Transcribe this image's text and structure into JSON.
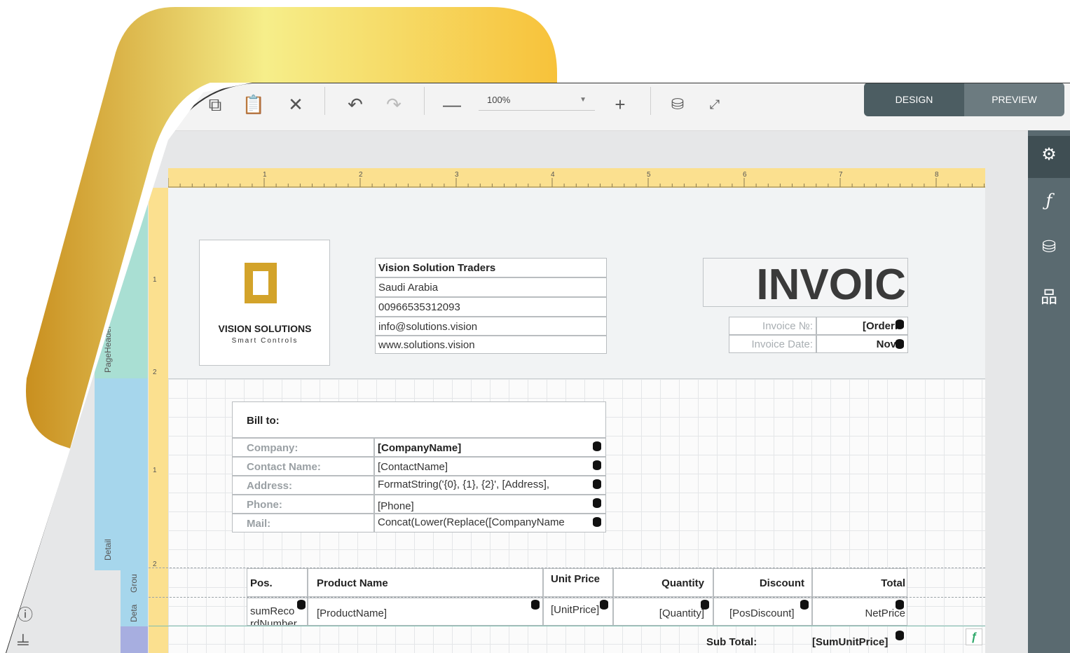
{
  "toolbar": {
    "zoom_value": "100%",
    "modes": {
      "design": "DESIGN",
      "preview": "PREVIEW"
    }
  },
  "bands": {
    "page_header": "PageHeader",
    "detail": "Detail",
    "group": "Grou",
    "detail2": "Deta"
  },
  "ruler": {
    "top": [
      "1",
      "2",
      "3",
      "4",
      "5",
      "6",
      "7",
      "8"
    ],
    "left_header": [
      "1",
      "2"
    ],
    "left_detail": [
      "1",
      "2"
    ]
  },
  "logo": {
    "name": "VISION SOLUTIONS",
    "tagline": "Smart Controls",
    "brand_color": "#d3a32a"
  },
  "company": {
    "name": "Vision Solution Traders",
    "country": "Saudi Arabia",
    "phone": "00966535312093",
    "email": "info@solutions.vision",
    "web": "www.solutions.vision"
  },
  "invoice": {
    "title": "INVOIC",
    "number_label": "Invoice №:",
    "number_value": "[OrderI",
    "date_label": "Invoice Date:",
    "date_value": "Nov"
  },
  "bill_to": {
    "heading": "Bill to:",
    "rows": [
      {
        "label": "Company:",
        "value": "[CompanyName]"
      },
      {
        "label": "Contact Name:",
        "value": "[ContactName]"
      },
      {
        "label": "Address:",
        "value": "FormatString('{0}, {1}, {2}', [Address],"
      },
      {
        "label": "Phone:",
        "value": "[Phone]"
      },
      {
        "label": "Mail:",
        "value": "Concat(Lower(Replace([CompanyName"
      }
    ]
  },
  "table": {
    "headers": [
      "Pos.",
      "Product Name",
      "Unit Price",
      "Quantity",
      "Discount",
      "Total"
    ],
    "row": [
      "sumRecordNumber",
      "[ProductName]",
      "[UnitPrice]",
      "[Quantity]",
      "[PosDiscount]",
      "NetPrice"
    ]
  },
  "subtotal": {
    "label": "Sub Total:",
    "value": "[SumUnitPrice]"
  },
  "colors": {
    "toolbar_bg": "#f3f3f3",
    "mode_active": "#4c5d62",
    "mode_inactive": "#6c7b80",
    "side_panel": "#5a6a70",
    "ruler": "#fbe08f"
  }
}
